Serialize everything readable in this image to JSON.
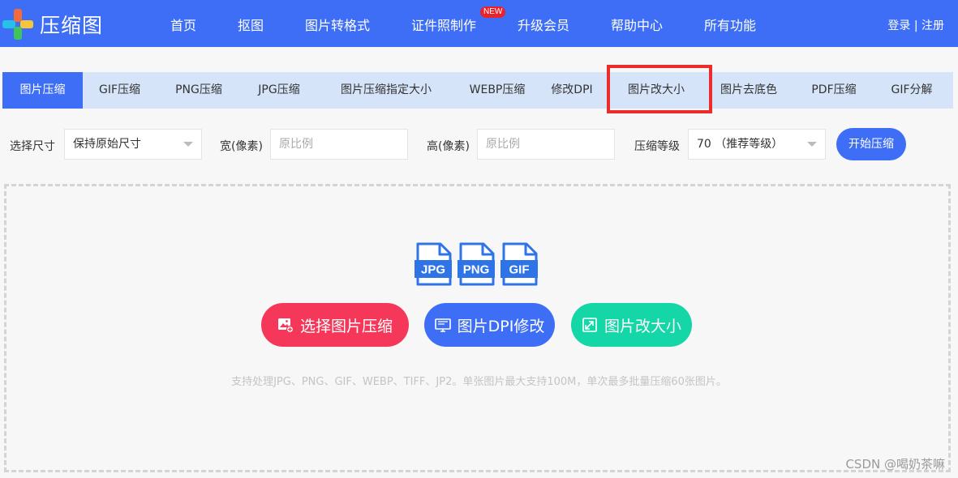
{
  "header": {
    "brand": "压缩图",
    "nav": [
      {
        "label": "首页"
      },
      {
        "label": "抠图"
      },
      {
        "label": "图片转格式"
      },
      {
        "label": "证件照制作",
        "badge": "NEW"
      },
      {
        "label": "升级会员"
      },
      {
        "label": "帮助中心"
      },
      {
        "label": "所有功能"
      }
    ],
    "login": "登录",
    "separator": " | ",
    "register": "注册"
  },
  "tabs": [
    {
      "label": "图片压缩",
      "active": true
    },
    {
      "label": "GIF压缩"
    },
    {
      "label": "PNG压缩"
    },
    {
      "label": "JPG压缩"
    },
    {
      "label": "图片压缩指定大小"
    },
    {
      "label": "WEBP压缩"
    },
    {
      "label": "修改DPI"
    },
    {
      "label": "图片改大小",
      "highlighted": true
    },
    {
      "label": "图片去底色"
    },
    {
      "label": "PDF压缩"
    },
    {
      "label": "GIF分解"
    }
  ],
  "options": {
    "size_label": "选择尺寸",
    "size_value": "保持原始尺寸",
    "width_label": "宽(像素)",
    "width_placeholder": "原比例",
    "height_label": "高(像素)",
    "height_placeholder": "原比例",
    "level_label": "压缩等级",
    "level_value": "70 （推荐等级）",
    "start_button": "开始压缩"
  },
  "upload": {
    "file_types": [
      "JPG",
      "PNG",
      "GIF"
    ],
    "buttons": [
      {
        "label": "选择图片压缩",
        "color": "#f5385a",
        "icon": "image-upload-icon"
      },
      {
        "label": "图片DPI修改",
        "color": "#3d6ef5",
        "icon": "monitor-icon"
      },
      {
        "label": "图片改大小",
        "color": "#14d6a6",
        "icon": "resize-icon"
      }
    ],
    "hint": "支持处理JPG、PNG、GIF、WEBP、TIFF、JP2。单张图片最大支持100M，单次最多批量压缩60张图片。"
  },
  "watermark": "CSDN @喝奶茶嘛",
  "colors": {
    "primary": "#3d6ef5",
    "tab_bar": "#d6e4f9",
    "highlight": "#ec2b2b",
    "badge": "#e8232c"
  }
}
